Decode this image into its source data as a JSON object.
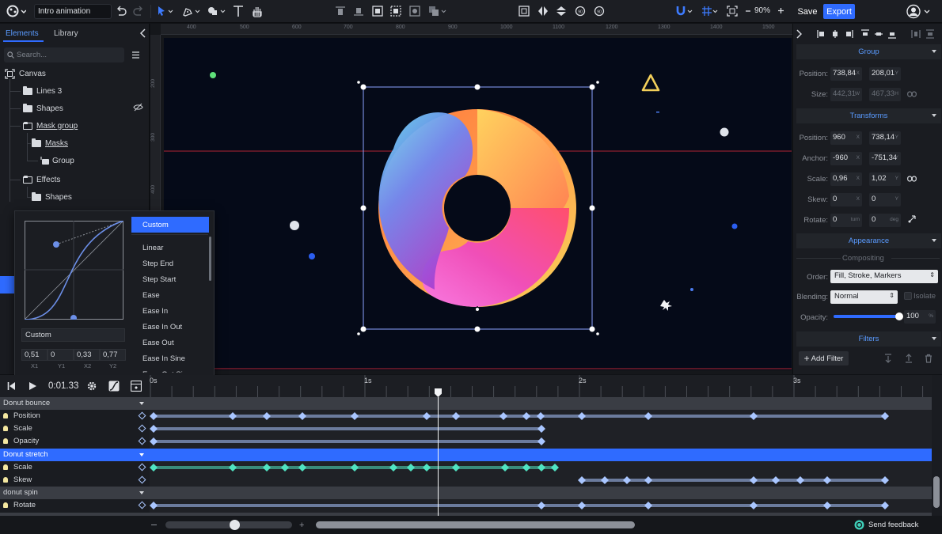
{
  "app": {
    "doc_name": "Intro animation",
    "save_label": "Save",
    "export_label": "Export",
    "zoom": "90%"
  },
  "left": {
    "tabs": [
      "Elements",
      "Library"
    ],
    "search_placeholder": "Search...",
    "tree": [
      {
        "label": "Canvas"
      },
      {
        "label": "Lines 3"
      },
      {
        "label": "Shapes"
      },
      {
        "label": "Mask group"
      },
      {
        "label": "Masks"
      },
      {
        "label": "Group"
      },
      {
        "label": "Effects"
      },
      {
        "label": "Shapes"
      }
    ]
  },
  "easing": {
    "items": [
      "Custom",
      "Linear",
      "Step End",
      "Step Start",
      "Ease",
      "Ease In",
      "Ease In Out",
      "Ease Out",
      "Ease In Sine",
      "Ease Out Sine"
    ],
    "selected": "Custom",
    "name": "Custom",
    "values": [
      {
        "v": "0,51",
        "l": "X1"
      },
      {
        "v": "0",
        "l": "Y1"
      },
      {
        "v": "0,33",
        "l": "X2"
      },
      {
        "v": "0,77",
        "l": "Y2"
      }
    ]
  },
  "ruler": {
    "top": [
      "400",
      "500",
      "600",
      "700",
      "800",
      "900",
      "1000",
      "1100",
      "1200",
      "1300",
      "1400",
      "1500"
    ],
    "left": [
      "200",
      "300",
      "400"
    ]
  },
  "right": {
    "group_title": "Group",
    "position_label": "Position:",
    "position_x": "738,84",
    "position_y": "208,01",
    "size_label": "Size:",
    "size_w": "442,31",
    "size_h": "467,33",
    "transforms_title": "Transforms",
    "t_position_label": "Position:",
    "t_pos_x": "960",
    "t_pos_y": "738,14",
    "anchor_label": "Anchor:",
    "anchor_x": "-960",
    "anchor_y": "-751,34",
    "scale_label": "Scale:",
    "scale_x": "0,96",
    "scale_y": "1,02",
    "skew_label": "Skew:",
    "skew_x": "0",
    "skew_y": "0",
    "rotate_label": "Rotate:",
    "rotate_a": "0",
    "rotate_b": "0",
    "rotate_unit_a": "turn",
    "rotate_unit_b": "deg",
    "appearance_title": "Appearance",
    "compositing_label": "Compositing",
    "order_label": "Order:",
    "order_value": "Fill, Stroke, Markers",
    "blending_label": "Blending:",
    "blending_value": "Normal",
    "isolate_label": "Isolate",
    "opacity_label": "Opacity:",
    "opacity_value": "100",
    "opacity_fraction": 1.0,
    "filters_title": "Filters",
    "add_filter_label": "Add Filter"
  },
  "timeline": {
    "time": "0:01.33",
    "ticks": [
      "0s",
      "1s",
      "2s",
      "3s"
    ],
    "rows": [
      {
        "type": "group",
        "label": "Donut bounce"
      },
      {
        "type": "prop",
        "label": "Position"
      },
      {
        "type": "prop",
        "label": "Scale"
      },
      {
        "type": "prop",
        "label": "Opacity"
      },
      {
        "type": "group",
        "label": "Donut stretch",
        "selected": true
      },
      {
        "type": "prop",
        "label": "Scale"
      },
      {
        "type": "prop",
        "label": "Skew"
      },
      {
        "type": "group",
        "label": "donut spin"
      },
      {
        "type": "prop",
        "label": "Rotate"
      }
    ],
    "send_feedback": "Send feedback"
  }
}
